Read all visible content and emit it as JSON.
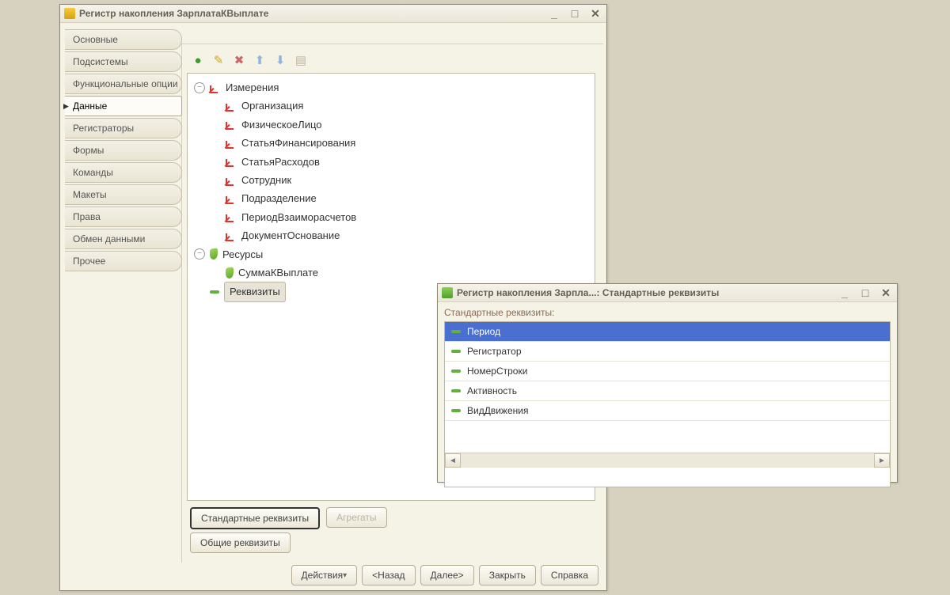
{
  "mainWindow": {
    "title": "Регистр накопления ЗарплатаКВыплате",
    "sidebar": [
      "Основные",
      "Подсистемы",
      "Функциональные опции",
      "Данные",
      "Регистраторы",
      "Формы",
      "Команды",
      "Макеты",
      "Права",
      "Обмен данными",
      "Прочее"
    ],
    "activeTabIndex": 3,
    "tree": {
      "dimensions": {
        "label": "Измерения",
        "items": [
          "Организация",
          "ФизическоеЛицо",
          "СтатьяФинансирования",
          "СтатьяРасходов",
          "Сотрудник",
          "Подразделение",
          "ПериодВзаиморасчетов",
          "ДокументОснование"
        ]
      },
      "resources": {
        "label": "Ресурсы",
        "items": [
          "СуммаКВыплате"
        ]
      },
      "requisites": {
        "label": "Реквизиты"
      }
    },
    "bottomButtons": {
      "standard": "Стандартные реквизиты",
      "aggregates": "Агрегаты",
      "common": "Общие реквизиты"
    },
    "footer": {
      "actions": "Действия",
      "back": "<Назад",
      "next": "Далее>",
      "close": "Закрыть",
      "help": "Справка"
    }
  },
  "popup": {
    "title": "Регистр накопления Зарпла...: Стандартные реквизиты",
    "label": "Стандартные реквизиты:",
    "items": [
      "Период",
      "Регистратор",
      "НомерСтроки",
      "Активность",
      "ВидДвижения"
    ],
    "selectedIndex": 0
  }
}
